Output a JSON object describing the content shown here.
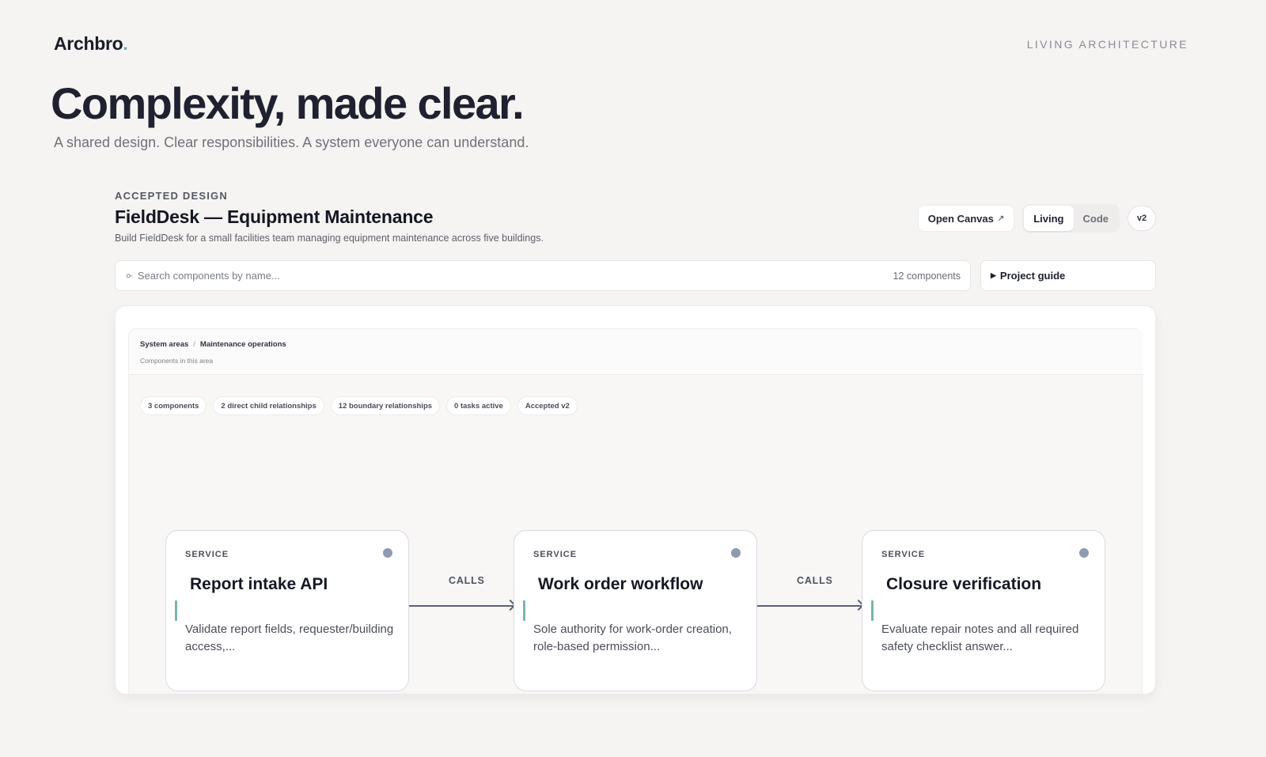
{
  "header": {
    "brand": "Archbro",
    "brand_dot": ".",
    "tagline": "LIVING ARCHITECTURE",
    "title": "Complexity, made clear.",
    "subtitle": "A shared design. Clear responsibilities. A system everyone can understand."
  },
  "design": {
    "eyebrow": "ACCEPTED DESIGN",
    "title": "FieldDesk — Equipment Maintenance",
    "description": "Build FieldDesk for a small facilities team managing equipment maintenance across five buildings.",
    "open_canvas_label": "Open Canvas",
    "open_canvas_icon": "↗",
    "view_modes": [
      "Living",
      "Code"
    ],
    "active_view": "Living",
    "version": "v2"
  },
  "search": {
    "placeholder": "Search components by name...",
    "count": "12 components",
    "icon": "⌕"
  },
  "guide": {
    "label": "Project guide",
    "icon": "▶"
  },
  "canvas": {
    "breadcrumb": [
      "System areas",
      "Maintenance operations"
    ],
    "breadcrumb_sep": "/",
    "subtitle": "Components in this area",
    "chips": [
      "3 components",
      "2 direct child relationships",
      "12 boundary relationships",
      "0 tasks active",
      "Accepted v2"
    ],
    "nodes": [
      {
        "kind": "SERVICE",
        "name": "Report intake API",
        "description": "Validate report fields, requester/building access,..."
      },
      {
        "kind": "SERVICE",
        "name": "Work order workflow",
        "description": "Sole authority for work-order creation, role-based permission..."
      },
      {
        "kind": "SERVICE",
        "name": "Closure verification",
        "description": "Evaluate repair notes and all required safety checklist answer..."
      }
    ],
    "edges": [
      {
        "from": "Report intake API",
        "to": "Work order workflow",
        "label": "CALLS"
      },
      {
        "from": "Work order workflow",
        "to": "Closure verification",
        "label": "CALLS"
      }
    ]
  },
  "colors": {
    "background": "#f6f4f2",
    "accent_teal": "#7ab5ae",
    "status_dot": "#8f9ab0",
    "edge": "#5c6178"
  }
}
